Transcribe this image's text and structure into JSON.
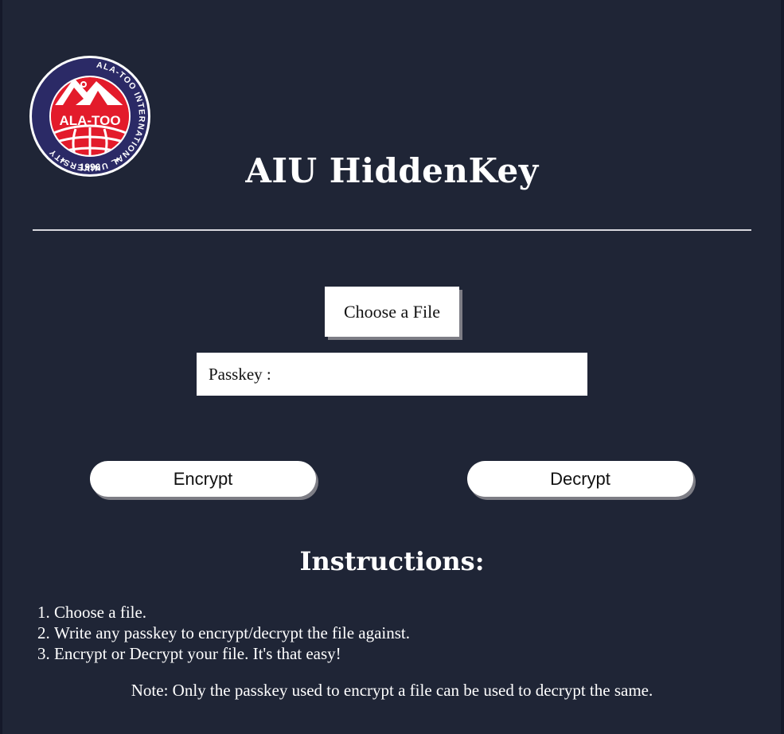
{
  "logo": {
    "ring_text": "ALA-TOO INTERNATIONAL UNIVERSITY",
    "center_text": "ALA-TOO",
    "year": "1996"
  },
  "header": {
    "title": "AIU HiddenKey"
  },
  "form": {
    "file_button_label": "Choose a File",
    "passkey_label": "Passkey :",
    "passkey_value": "",
    "passkey_placeholder": ""
  },
  "actions": {
    "encrypt_label": "Encrypt",
    "decrypt_label": "Decrypt"
  },
  "instructions": {
    "title": "Instructions:",
    "steps": [
      "Choose a file.",
      "Write any passkey to encrypt/decrypt the file against.",
      "Encrypt or Decrypt your file. It's that easy!"
    ],
    "note": "Note: Only the passkey used to encrypt a file can be used to decrypt the same."
  },
  "colors": {
    "background": "#1f2536",
    "text": "#ffffff",
    "logo_navy": "#2b2a66",
    "logo_red": "#e31b2b",
    "button_shadow": "#7d7d85"
  },
  "icons": {
    "logo": "university-logo-icon"
  }
}
